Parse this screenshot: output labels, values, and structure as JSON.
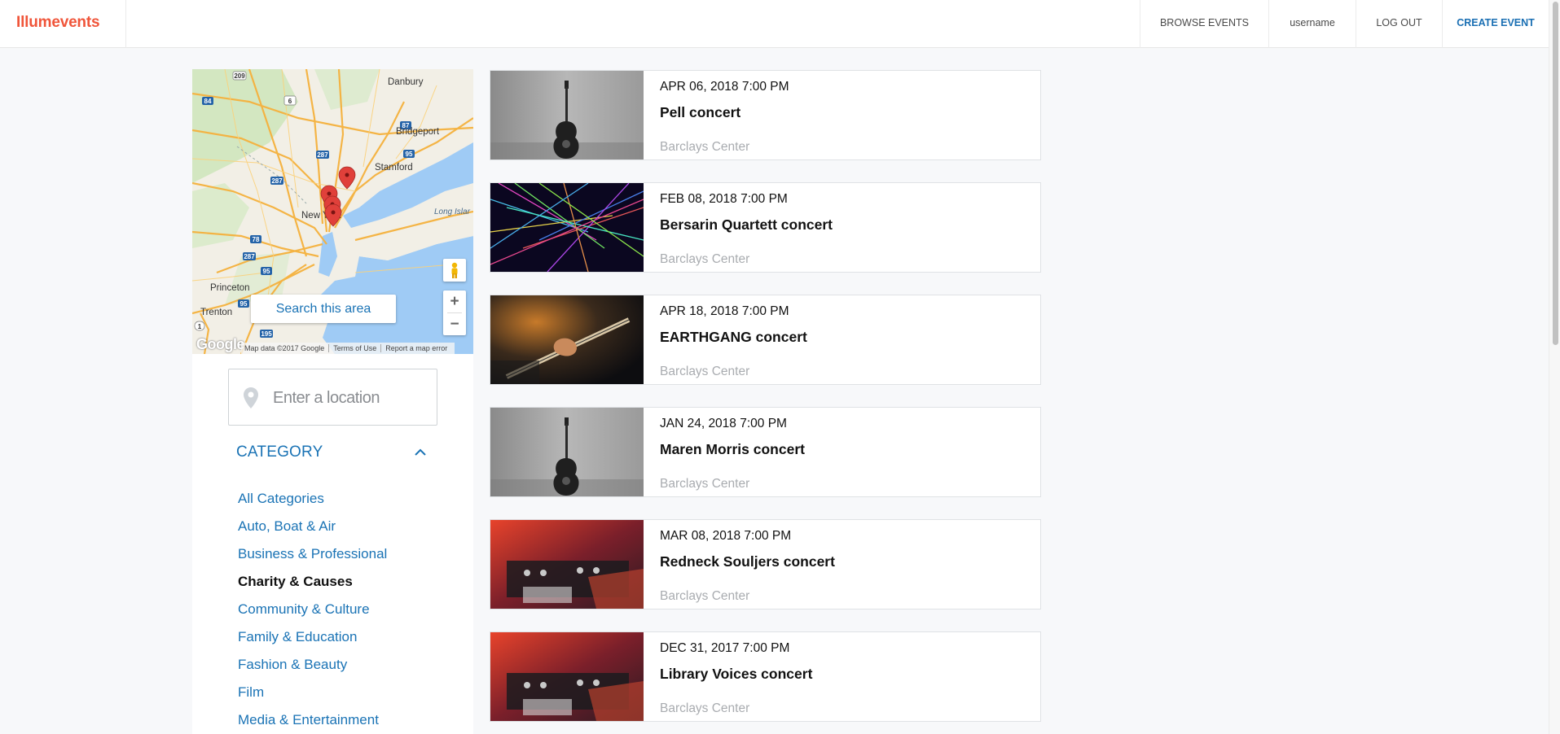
{
  "brand": {
    "name": "Illumevents",
    "color": "#f0553a"
  },
  "nav": {
    "browse": "BROWSE EVENTS",
    "username": "username",
    "logout": "LOG OUT",
    "create": "CREATE EVENT"
  },
  "map": {
    "search_button": "Search this area",
    "zoom_in": "+",
    "zoom_out": "−",
    "google": "Google",
    "attribution": {
      "data": "Map data ©2017 Google",
      "terms": "Terms of Use",
      "report": "Report a map error"
    },
    "labels": {
      "danbury": "Danbury",
      "bridgeport": "Bridgeport",
      "stamford": "Stamford",
      "new_york": "New York",
      "long_island": "Long Islar",
      "princeton": "Princeton",
      "trenton": "Trenton"
    },
    "shields": [
      "209",
      "84",
      "6",
      "287",
      "95",
      "87",
      "287",
      "78",
      "287",
      "95",
      "1",
      "195",
      "95"
    ]
  },
  "location": {
    "placeholder": "Enter a location"
  },
  "category": {
    "title": "CATEGORY",
    "items": [
      {
        "label": "All Categories",
        "active": false
      },
      {
        "label": "Auto, Boat & Air",
        "active": false
      },
      {
        "label": "Business & Professional",
        "active": false
      },
      {
        "label": "Charity & Causes",
        "active": true
      },
      {
        "label": "Community & Culture",
        "active": false
      },
      {
        "label": "Family & Education",
        "active": false
      },
      {
        "label": "Fashion & Beauty",
        "active": false
      },
      {
        "label": "Film",
        "active": false
      },
      {
        "label": "Media & Entertainment",
        "active": false
      }
    ]
  },
  "events": [
    {
      "date": "APR 06, 2018 7:00 PM",
      "title": "Pell concert",
      "venue": "Barclays Center",
      "image": "guitar-wall"
    },
    {
      "date": "FEB 08, 2018 7:00 PM",
      "title": "Bersarin Quartett concert",
      "venue": "Barclays Center",
      "image": "lasers"
    },
    {
      "date": "APR 18, 2018 7:00 PM",
      "title": "EARTHGANG concert",
      "venue": "Barclays Center",
      "image": "bass-guitar"
    },
    {
      "date": "JAN 24, 2018 7:00 PM",
      "title": "Maren Morris concert",
      "venue": "Barclays Center",
      "image": "guitar-wall"
    },
    {
      "date": "MAR 08, 2018 7:00 PM",
      "title": "Redneck Souljers concert",
      "venue": "Barclays Center",
      "image": "dj-mixer"
    },
    {
      "date": "DEC 31, 2017 7:00 PM",
      "title": "Library Voices concert",
      "venue": "Barclays Center",
      "image": "dj-mixer"
    }
  ]
}
